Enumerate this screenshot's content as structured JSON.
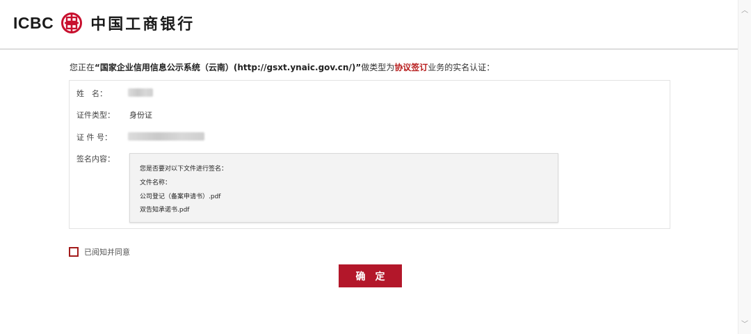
{
  "header": {
    "logo_en": "ICBC",
    "logo_cn": "中国工商银行",
    "brand_color": "#c8102e"
  },
  "intro": {
    "prefix": "您正在",
    "system": "“国家企业信用信息公示系统（云南）(http://gsxt.ynaic.gov.cn/)”",
    "middle": "做类型为",
    "business": "协议签订",
    "suffix": "业务的实名认证："
  },
  "form": {
    "name_label": "姓　名：",
    "id_type_label": "证件类型：",
    "id_type_value": "身份证",
    "id_number_label": "证 件 号：",
    "sign_content_label": "签名内容：",
    "content_lines": [
      "您是否要对以下文件进行签名：",
      "文件名称：",
      "公司登记（备案申请书）.pdf",
      "双告知承诺书.pdf"
    ]
  },
  "agree": {
    "label": "已阅知并同意"
  },
  "confirm_button": {
    "label": "确定",
    "color": "#b3172a"
  },
  "icons": {
    "logo_mark": "icbc-logo-icon",
    "scroll_up": "chevron-up-icon",
    "scroll_down": "chevron-down-icon"
  }
}
